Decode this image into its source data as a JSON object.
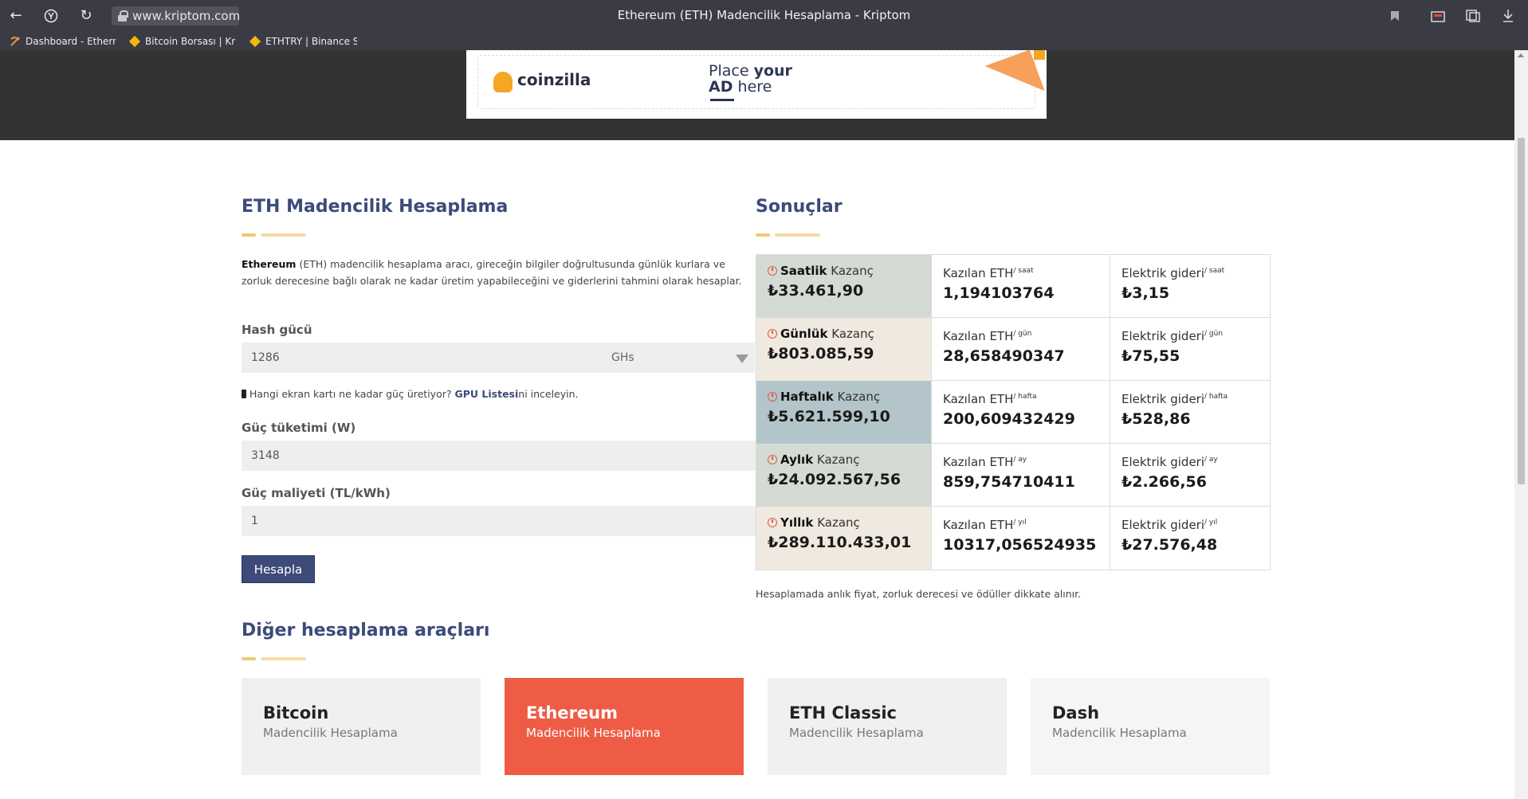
{
  "browser": {
    "url": "www.kriptom.com",
    "title": "Ethereum (ETH) Madencilik Hesaplama - Kriptom",
    "bookmarks": [
      {
        "label": "Dashboard - Ethern"
      },
      {
        "label": "Bitcoin Borsası | Kri"
      },
      {
        "label": "ETHTRY | Binance S"
      }
    ]
  },
  "ad": {
    "brand": "coinzilla",
    "line1_a": "Place ",
    "line1_b": "your",
    "line2_a": "AD",
    "line2_b": " here"
  },
  "calculator": {
    "heading": "ETH Madencilik Hesaplama",
    "intro_bold": "Ethereum",
    "intro_rest": " (ETH) madencilik hesaplama aracı, gireceğin bilgiler doğrultusunda günlük kurlara ve zorluk derecesine bağlı olarak ne kadar üretim yapabileceğini ve giderlerini tahmini olarak hesaplar.",
    "hash_label": "Hash gücü",
    "hash_value": "1286",
    "hash_unit": "GHs",
    "gpu_note_pre": "Hangi ekran kartı ne kadar güç üretiyor? ",
    "gpu_note_link": "GPU Listesi",
    "gpu_note_post": "ni inceleyin.",
    "power_label": "Güç tüketimi (W)",
    "power_value": "3148",
    "cost_label": "Güç maliyeti (TL/kWh)",
    "cost_value": "1",
    "button": "Hesapla"
  },
  "results": {
    "heading": "Sonuçlar",
    "kazanc_word": "Kazanç",
    "eth_label": "Kazılan ETH",
    "elec_label": "Elektrik gideri",
    "rows": [
      {
        "period": "Saatlik",
        "unit": "/ saat",
        "earning": "₺33.461,90",
        "eth": "1,194103764",
        "elec": "₺3,15",
        "bg": "#d4dbd5"
      },
      {
        "period": "Günlük",
        "unit": "/ gün",
        "earning": "₺803.085,59",
        "eth": "28,658490347",
        "elec": "₺75,55",
        "bg": "#efe9df"
      },
      {
        "period": "Haftalık",
        "unit": "/ hafta",
        "earning": "₺5.621.599,10",
        "eth": "200,609432429",
        "elec": "₺528,86",
        "bg": "#b3c5ca"
      },
      {
        "period": "Aylık",
        "unit": "/ ay",
        "earning": "₺24.092.567,56",
        "eth": "859,754710411",
        "elec": "₺2.266,56",
        "bg": "#d4dbd5"
      },
      {
        "period": "Yıllık",
        "unit": "/ yıl",
        "earning": "₺289.110.433,01",
        "eth": "10317,056524935",
        "elec": "₺27.576,48",
        "bg": "#efe9df"
      }
    ],
    "note": "Hesaplamada anlık fiyat, zorluk derecesi ve ödüller dikkate alınır."
  },
  "other_tools": {
    "heading": "Diğer hesaplama araçları",
    "items": [
      {
        "title": "Bitcoin",
        "subtitle": "Madencilik Hesaplama",
        "bg": "#f1f0ee",
        "active": false
      },
      {
        "title": "Ethereum",
        "subtitle": "Madencilik Hesaplama",
        "bg": "#ee5c46",
        "active": true
      },
      {
        "title": "ETH Classic",
        "subtitle": "Madencilik Hesaplama",
        "bg": "#f1f0ee",
        "active": false
      },
      {
        "title": "Dash",
        "subtitle": "Madencilik Hesaplama",
        "bg": "#f5f5f5",
        "active": false
      }
    ]
  }
}
